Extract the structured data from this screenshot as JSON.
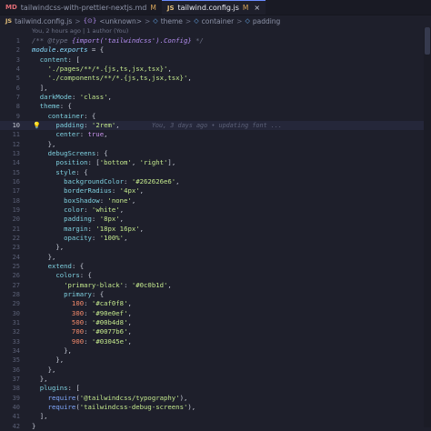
{
  "tabs": [
    {
      "icon": "MD",
      "label": "tailwindcss-with-prettier-nextjs.md",
      "modified": "M",
      "active": false
    },
    {
      "icon": "JS",
      "label": "tailwind.config.js",
      "modified": "M",
      "close": "×",
      "active": true
    }
  ],
  "breadcrumb": {
    "file_icon": "JS",
    "file": "tailwind.config.js",
    "unknown": "<unknown>",
    "theme": "theme",
    "container": "container",
    "padding": "padding",
    "sep": ">"
  },
  "codelens": "You, 2 hours ago | 1 author (You)",
  "current_line": 10,
  "bulb_icon": "lightbulb-icon",
  "blame": "You, 3 days ago • updating font ...",
  "lines": [
    {
      "n": "1",
      "fold": "",
      "tokens": [
        {
          "t": "/** ",
          "c": "com"
        },
        {
          "t": "@type",
          "c": "com"
        },
        {
          "t": " {import('tailwindcss').Config}",
          "c": "type"
        },
        {
          "t": " */",
          "c": "com"
        }
      ]
    },
    {
      "n": "2",
      "fold": "",
      "tokens": [
        {
          "t": "module",
          "c": "mod"
        },
        {
          "t": ".",
          "c": "p"
        },
        {
          "t": "exports",
          "c": "mod"
        },
        {
          "t": " = {",
          "c": "p"
        }
      ]
    },
    {
      "n": "3",
      "fold": "",
      "tokens": [
        {
          "t": "  content",
          "c": "key"
        },
        {
          "t": ": [",
          "c": "p"
        }
      ]
    },
    {
      "n": "4",
      "fold": "",
      "tokens": [
        {
          "t": "    ",
          "c": "p"
        },
        {
          "t": "'./pages/**/*.{js,ts,jsx,tsx}'",
          "c": "str"
        },
        {
          "t": ",",
          "c": "p"
        }
      ]
    },
    {
      "n": "5",
      "fold": "",
      "tokens": [
        {
          "t": "    ",
          "c": "p"
        },
        {
          "t": "'./components/**/*.{js,ts,jsx,tsx}'",
          "c": "str"
        },
        {
          "t": ",",
          "c": "p"
        }
      ]
    },
    {
      "n": "6",
      "fold": "",
      "tokens": [
        {
          "t": "  ],",
          "c": "p"
        }
      ]
    },
    {
      "n": "7",
      "fold": "",
      "tokens": [
        {
          "t": "  darkMode",
          "c": "key"
        },
        {
          "t": ": ",
          "c": "p"
        },
        {
          "t": "'class'",
          "c": "str"
        },
        {
          "t": ",",
          "c": "p"
        }
      ]
    },
    {
      "n": "8",
      "fold": "",
      "tokens": [
        {
          "t": "  theme",
          "c": "key"
        },
        {
          "t": ": {",
          "c": "p"
        }
      ]
    },
    {
      "n": "9",
      "fold": "",
      "tokens": [
        {
          "t": "    container",
          "c": "key"
        },
        {
          "t": ": {",
          "c": "p"
        }
      ]
    },
    {
      "n": "10",
      "fold": "",
      "tokens": [
        {
          "t": "      padding",
          "c": "key"
        },
        {
          "t": ": ",
          "c": "p"
        },
        {
          "t": "'2rem'",
          "c": "str"
        },
        {
          "t": ",",
          "c": "p"
        }
      ]
    },
    {
      "n": "11",
      "fold": "",
      "tokens": [
        {
          "t": "      center",
          "c": "key"
        },
        {
          "t": ": ",
          "c": "p"
        },
        {
          "t": "true",
          "c": "kw"
        },
        {
          "t": ",",
          "c": "p"
        }
      ]
    },
    {
      "n": "12",
      "fold": "",
      "tokens": [
        {
          "t": "    },",
          "c": "p"
        }
      ]
    },
    {
      "n": "13",
      "fold": "",
      "tokens": [
        {
          "t": "    debugScreens",
          "c": "key"
        },
        {
          "t": ": {",
          "c": "p"
        }
      ]
    },
    {
      "n": "14",
      "fold": "",
      "tokens": [
        {
          "t": "      position",
          "c": "key"
        },
        {
          "t": ": [",
          "c": "p"
        },
        {
          "t": "'bottom'",
          "c": "str"
        },
        {
          "t": ", ",
          "c": "p"
        },
        {
          "t": "'right'",
          "c": "str"
        },
        {
          "t": "],",
          "c": "p"
        }
      ]
    },
    {
      "n": "15",
      "fold": "",
      "tokens": [
        {
          "t": "      style",
          "c": "key"
        },
        {
          "t": ": {",
          "c": "p"
        }
      ]
    },
    {
      "n": "16",
      "fold": "",
      "tokens": [
        {
          "t": "        backgroundColor",
          "c": "key"
        },
        {
          "t": ": ",
          "c": "p"
        },
        {
          "t": "'#262626e6'",
          "c": "str"
        },
        {
          "t": ",",
          "c": "p"
        }
      ]
    },
    {
      "n": "17",
      "fold": "",
      "tokens": [
        {
          "t": "        borderRadius",
          "c": "key"
        },
        {
          "t": ": ",
          "c": "p"
        },
        {
          "t": "'4px'",
          "c": "str"
        },
        {
          "t": ",",
          "c": "p"
        }
      ]
    },
    {
      "n": "18",
      "fold": "",
      "tokens": [
        {
          "t": "        boxShadow",
          "c": "key"
        },
        {
          "t": ": ",
          "c": "p"
        },
        {
          "t": "'none'",
          "c": "str"
        },
        {
          "t": ",",
          "c": "p"
        }
      ]
    },
    {
      "n": "19",
      "fold": "",
      "tokens": [
        {
          "t": "        color",
          "c": "key"
        },
        {
          "t": ": ",
          "c": "p"
        },
        {
          "t": "'white'",
          "c": "str"
        },
        {
          "t": ",",
          "c": "p"
        }
      ]
    },
    {
      "n": "20",
      "fold": "",
      "tokens": [
        {
          "t": "        padding",
          "c": "key"
        },
        {
          "t": ": ",
          "c": "p"
        },
        {
          "t": "'8px'",
          "c": "str"
        },
        {
          "t": ",",
          "c": "p"
        }
      ]
    },
    {
      "n": "21",
      "fold": "",
      "tokens": [
        {
          "t": "        margin",
          "c": "key"
        },
        {
          "t": ": ",
          "c": "p"
        },
        {
          "t": "'18px 16px'",
          "c": "str"
        },
        {
          "t": ",",
          "c": "p"
        }
      ]
    },
    {
      "n": "22",
      "fold": "",
      "tokens": [
        {
          "t": "        opacity",
          "c": "key"
        },
        {
          "t": ": ",
          "c": "p"
        },
        {
          "t": "'100%'",
          "c": "str"
        },
        {
          "t": ",",
          "c": "p"
        }
      ]
    },
    {
      "n": "23",
      "fold": "",
      "tokens": [
        {
          "t": "      },",
          "c": "p"
        }
      ]
    },
    {
      "n": "24",
      "fold": "",
      "tokens": [
        {
          "t": "    },",
          "c": "p"
        }
      ]
    },
    {
      "n": "25",
      "fold": "",
      "tokens": [
        {
          "t": "    extend",
          "c": "key"
        },
        {
          "t": ": {",
          "c": "p"
        }
      ]
    },
    {
      "n": "26",
      "fold": "",
      "tokens": [
        {
          "t": "      colors",
          "c": "key"
        },
        {
          "t": ": {",
          "c": "p"
        }
      ]
    },
    {
      "n": "27",
      "fold": "",
      "tokens": [
        {
          "t": "        ",
          "c": "p"
        },
        {
          "t": "'primary-black'",
          "c": "str"
        },
        {
          "t": ": ",
          "c": "p"
        },
        {
          "t": "'#0c0b1d'",
          "c": "str"
        },
        {
          "t": ",",
          "c": "p"
        }
      ]
    },
    {
      "n": "28",
      "fold": "",
      "tokens": [
        {
          "t": "        primary",
          "c": "key"
        },
        {
          "t": ": {",
          "c": "p"
        }
      ]
    },
    {
      "n": "29",
      "fold": "",
      "tokens": [
        {
          "t": "          100",
          "c": "num"
        },
        {
          "t": ": ",
          "c": "p"
        },
        {
          "t": "'#caf0f8'",
          "c": "str"
        },
        {
          "t": ",",
          "c": "p"
        }
      ]
    },
    {
      "n": "30",
      "fold": "",
      "tokens": [
        {
          "t": "          300",
          "c": "num"
        },
        {
          "t": ": ",
          "c": "p"
        },
        {
          "t": "'#90e0ef'",
          "c": "str"
        },
        {
          "t": ",",
          "c": "p"
        }
      ]
    },
    {
      "n": "31",
      "fold": "",
      "tokens": [
        {
          "t": "          500",
          "c": "num"
        },
        {
          "t": ": ",
          "c": "p"
        },
        {
          "t": "'#00b4d8'",
          "c": "str"
        },
        {
          "t": ",",
          "c": "p"
        }
      ]
    },
    {
      "n": "32",
      "fold": "",
      "tokens": [
        {
          "t": "          700",
          "c": "num"
        },
        {
          "t": ": ",
          "c": "p"
        },
        {
          "t": "'#0077b6'",
          "c": "str"
        },
        {
          "t": ",",
          "c": "p"
        }
      ]
    },
    {
      "n": "33",
      "fold": "",
      "tokens": [
        {
          "t": "          900",
          "c": "num"
        },
        {
          "t": ": ",
          "c": "p"
        },
        {
          "t": "'#03045e'",
          "c": "str"
        },
        {
          "t": ",",
          "c": "p"
        }
      ]
    },
    {
      "n": "34",
      "fold": "",
      "tokens": [
        {
          "t": "        },",
          "c": "p"
        }
      ]
    },
    {
      "n": "35",
      "fold": "",
      "tokens": [
        {
          "t": "      },",
          "c": "p"
        }
      ]
    },
    {
      "n": "36",
      "fold": "",
      "tokens": [
        {
          "t": "    },",
          "c": "p"
        }
      ]
    },
    {
      "n": "37",
      "fold": "",
      "tokens": [
        {
          "t": "  },",
          "c": "p"
        }
      ]
    },
    {
      "n": "38",
      "fold": "",
      "tokens": [
        {
          "t": "  plugins",
          "c": "key"
        },
        {
          "t": ": [",
          "c": "p"
        }
      ]
    },
    {
      "n": "39",
      "fold": "",
      "tokens": [
        {
          "t": "    ",
          "c": "p"
        },
        {
          "t": "require",
          "c": "fn"
        },
        {
          "t": "(",
          "c": "p"
        },
        {
          "t": "'@tailwindcss/typography'",
          "c": "str"
        },
        {
          "t": "),",
          "c": "p"
        }
      ]
    },
    {
      "n": "40",
      "fold": "",
      "tokens": [
        {
          "t": "    ",
          "c": "p"
        },
        {
          "t": "require",
          "c": "fn"
        },
        {
          "t": "(",
          "c": "p"
        },
        {
          "t": "'tailwindcss-debug-screens'",
          "c": "str"
        },
        {
          "t": "),",
          "c": "p"
        }
      ]
    },
    {
      "n": "41",
      "fold": "",
      "tokens": [
        {
          "t": "  ],",
          "c": "p"
        }
      ]
    },
    {
      "n": "42",
      "fold": "",
      "tokens": [
        {
          "t": "}",
          "c": "p"
        }
      ]
    }
  ],
  "colors": {
    "background": "#1e1f2b",
    "current_line": "#25273a",
    "accent": "#6b8cff",
    "modified": "#d7a55a"
  }
}
